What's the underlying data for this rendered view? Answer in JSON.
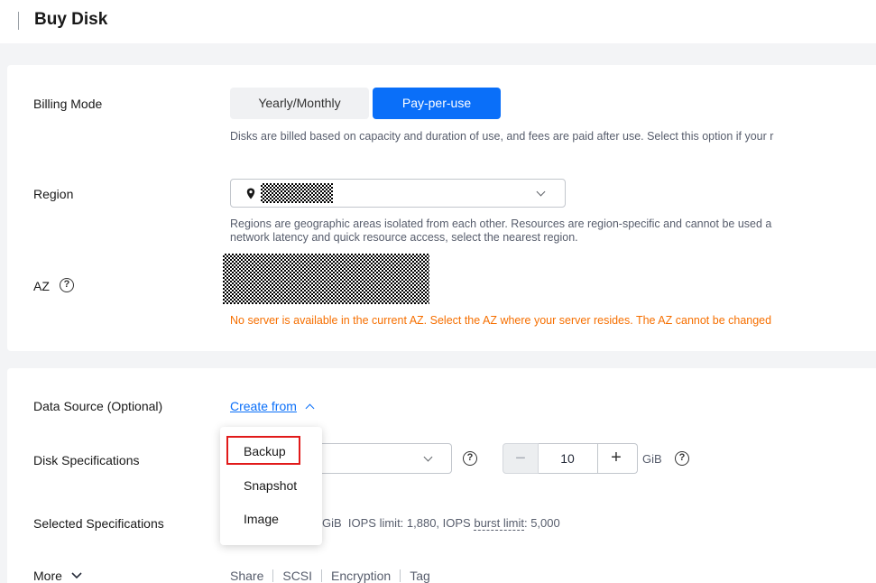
{
  "page": {
    "title": "Buy Disk"
  },
  "billing": {
    "label": "Billing Mode",
    "options": [
      "Yearly/Monthly",
      "Pay-per-use"
    ],
    "selected": "Pay-per-use",
    "tip": "Disks are billed based on capacity and duration of use, and fees are paid after use. Select this option if your r"
  },
  "region": {
    "label": "Region",
    "tip_line1": "Regions are geographic areas isolated from each other. Resources are region-specific and cannot be used a",
    "tip_line2": "network latency and quick resource access, select the nearest region."
  },
  "az": {
    "label": "AZ",
    "help": "?",
    "warning": "No server is available in the current AZ. Select the AZ where your server resides. The AZ cannot be changed"
  },
  "data_source": {
    "label": "Data Source (Optional)",
    "link": "Create from"
  },
  "dropdown": {
    "items": [
      "Backup",
      "Snapshot",
      "Image"
    ],
    "highlighted": "Backup"
  },
  "disk_specs": {
    "label": "Disk Specifications",
    "help": "?",
    "value": "10",
    "unit": "GiB",
    "minus": "−",
    "plus": "+"
  },
  "selected_specs": {
    "label": "Selected Specifications",
    "prefix": "GiB  IOPS limit: 1,880, IOPS ",
    "burst": "burst limit",
    "suffix": ": 5,000"
  },
  "more": {
    "label": "More",
    "tabs": [
      "Share",
      "SCSI",
      "Encryption",
      "Tag"
    ]
  },
  "colors": {
    "primary": "#0a6ff9",
    "warning": "#f66f00",
    "highlight": "#e11a1a"
  }
}
